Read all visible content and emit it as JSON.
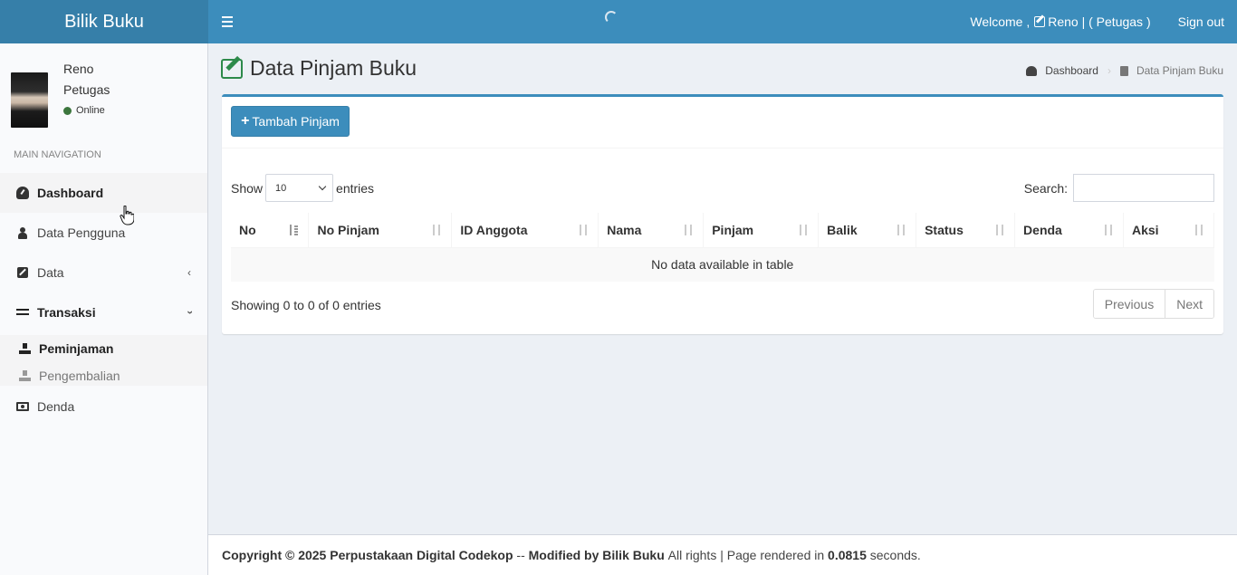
{
  "header": {
    "brand": "Bilik Buku",
    "welcome_prefix": "Welcome ,",
    "welcome_user": "Reno | ( Petugas )",
    "signout": "Sign out"
  },
  "sidebar": {
    "user": {
      "name": "Reno",
      "role": "Petugas",
      "status": "Online"
    },
    "nav_header": "MAIN NAVIGATION",
    "items": [
      {
        "label": "Dashboard"
      },
      {
        "label": "Data Pengguna"
      },
      {
        "label": "Data"
      },
      {
        "label": "Transaksi"
      },
      {
        "label": "Denda"
      }
    ],
    "subitems": [
      {
        "label": "Peminjaman"
      },
      {
        "label": "Pengembalian"
      }
    ]
  },
  "content": {
    "title": "Data Pinjam Buku",
    "breadcrumb": {
      "home": "Dashboard",
      "current": "Data Pinjam Buku"
    },
    "add_button": "Tambah Pinjam",
    "length": {
      "show": "Show",
      "value": "10",
      "entries": "entries"
    },
    "search_label": "Search:",
    "table": {
      "columns": [
        "No",
        "No Pinjam",
        "ID Anggota",
        "Nama",
        "Pinjam",
        "Balik",
        "Status",
        "Denda",
        "Aksi"
      ],
      "empty": "No data available in table"
    },
    "info": "Showing 0 to 0 of 0 entries",
    "pager": {
      "previous": "Previous",
      "next": "Next"
    }
  },
  "footer": {
    "copyright": "Copyright © 2025 Perpustakaan Digital Codekop",
    "sep": "--",
    "modified": "Modified by Bilik Buku",
    "rights": "All rights | Page rendered in",
    "time": "0.0815",
    "seconds": "seconds."
  }
}
